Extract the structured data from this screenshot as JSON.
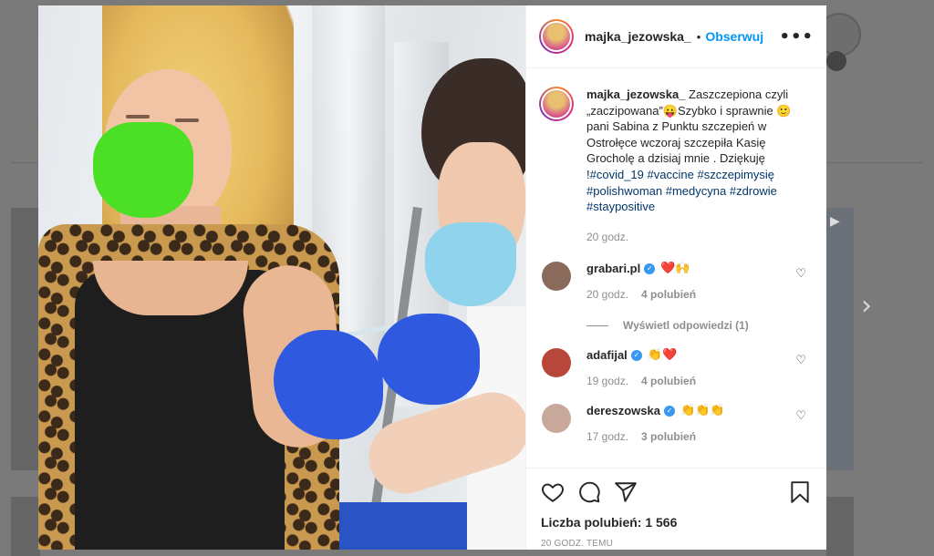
{
  "post": {
    "username": "majka_jezowska_",
    "dot": "•",
    "follow_label": "Obserwuj",
    "more_label": "•••",
    "caption_text": "Zaszczepiona czyli „zaczipowana”😛Szybko i sprawnie 🙂 pani Sabina z Punktu szczepień w Ostrołęce wczoraj szczepiła Kasię Grocholę a dzisiaj mnie . Dziękuję !",
    "hashtags": [
      "#covid_19",
      "#vaccine",
      "#szczepimysię",
      "#polishwoman",
      "#medycyna",
      "#zdrowie",
      "#staypositive"
    ],
    "caption_time": "20 godz."
  },
  "comments": [
    {
      "username": "grabari.pl",
      "text": "❤️🙌",
      "time": "20 godz.",
      "likes": "4 polubień",
      "avatar_color": "#8a6a5a"
    },
    {
      "username": "adafijal",
      "text": "👏❤️",
      "time": "19 godz.",
      "likes": "4 polubień",
      "avatar_color": "#b8463a"
    },
    {
      "username": "dereszowska",
      "text": "👏👏👏",
      "time": "17 godz.",
      "likes": "3 polubień",
      "avatar_color": "#c8a89a"
    }
  ],
  "replies_label": "Wyświetl odpowiedzi (1)",
  "likes_total": "Liczba polubień: 1 566",
  "post_timestamp": "20 GODZ. TEMU",
  "icons": {
    "like": "heart-icon",
    "comment": "comment-icon",
    "share": "share-icon",
    "save": "bookmark-icon",
    "comment_like": "heart-outline-icon",
    "verified": "verified-badge-icon",
    "next": "chevron-right-icon"
  },
  "colors": {
    "accent": "#0095f6",
    "verified": "#3897f0",
    "hashtag": "#00376b",
    "muted": "#8e8e8e"
  }
}
